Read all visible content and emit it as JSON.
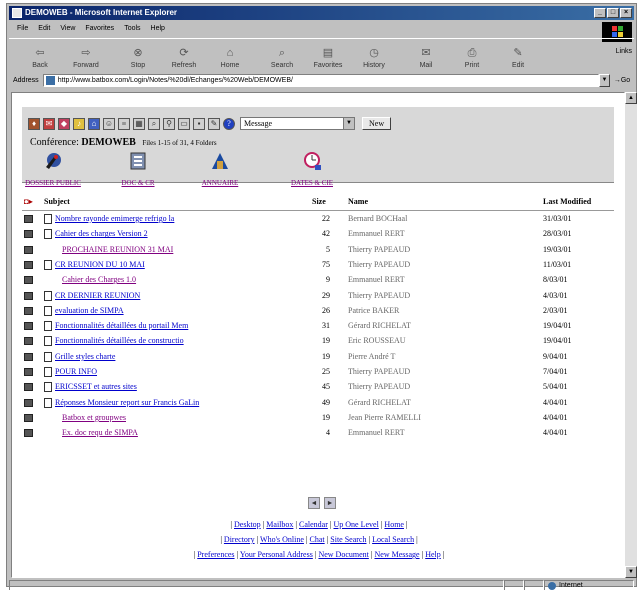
{
  "window": {
    "title": "DEMOWEB - Microsoft Internet Explorer",
    "controls": [
      "_",
      "□",
      "×"
    ]
  },
  "menu": [
    "File",
    "Edit",
    "View",
    "Favorites",
    "Tools",
    "Help"
  ],
  "toolbar": [
    {
      "label": "Back",
      "icon": "back-arrow-icon",
      "glyph": "⇦"
    },
    {
      "label": "Forward",
      "icon": "forward-arrow-icon",
      "glyph": "⇨"
    },
    {
      "label": "Stop",
      "icon": "stop-icon",
      "glyph": "⊗"
    },
    {
      "label": "Refresh",
      "icon": "refresh-icon",
      "glyph": "⟳"
    },
    {
      "label": "Home",
      "icon": "home-icon",
      "glyph": "⌂"
    },
    {
      "label": "Search",
      "icon": "search-icon",
      "glyph": "⌕"
    },
    {
      "label": "Favorites",
      "icon": "favorites-icon",
      "glyph": "▤"
    },
    {
      "label": "History",
      "icon": "history-icon",
      "glyph": "◷"
    },
    {
      "label": "Mail",
      "icon": "mail-icon",
      "glyph": "✉"
    },
    {
      "label": "Print",
      "icon": "print-icon",
      "glyph": "⎙"
    },
    {
      "label": "Edit",
      "icon": "edit-icon",
      "glyph": "✎"
    }
  ],
  "links_label": "Links",
  "address": {
    "label": "Address",
    "url": "http://www.batbox.com/Login/Notes/%20dl/Echanges/%20Web/DEMOWEB/",
    "go_label": "Go"
  },
  "page": {
    "message_select": "Message",
    "new_button": "New",
    "conference_label": "Conférence:",
    "conference_name": "DEMOWEB",
    "conference_info": "Files 1-15 of 31, 4 Folders",
    "folders": [
      {
        "label": "DOSSIER PUBLIC",
        "icon": "public-folder-icon"
      },
      {
        "label": "DOC & CR",
        "icon": "documents-folder-icon"
      },
      {
        "label": "ANNUAIRE",
        "icon": "directory-folder-icon"
      },
      {
        "label": "DATES & CIE",
        "icon": "calendar-folder-icon"
      }
    ],
    "columns": {
      "subject": "Subject",
      "size": "Size",
      "name": "Name",
      "modified": "Last Modified"
    },
    "rows": [
      {
        "subject": "Nombre rayonde emimerge refrigo la",
        "indent": false,
        "size": "22",
        "name": "Bernard BOCHaal",
        "date": "31/03/01"
      },
      {
        "subject": "Cahier des charges Version 2",
        "indent": false,
        "size": "42",
        "name": "Emmanuel RERT",
        "date": "28/03/01"
      },
      {
        "subject": "PROCHAINE REUNION 31 MAI",
        "indent": true,
        "size": "5",
        "name": "Thierry PAPEAUD",
        "date": "19/03/01"
      },
      {
        "subject": "CR REUNION DU 10 MAI",
        "indent": false,
        "size": "75",
        "name": "Thierry PAPEAUD",
        "date": "11/03/01"
      },
      {
        "subject": "Cahier des Charges 1.0",
        "indent": true,
        "size": "9",
        "name": "Emmanuel RERT",
        "date": "8/03/01"
      },
      {
        "subject": "CR DERNIER REUNION",
        "indent": false,
        "size": "29",
        "name": "Thierry PAPEAUD",
        "date": "4/03/01"
      },
      {
        "subject": "evaluation de SIMPA",
        "indent": false,
        "size": "26",
        "name": "Patrice BAKER",
        "date": "2/03/01"
      },
      {
        "subject": "Fonctionnalités détaillées du portail Mem",
        "indent": false,
        "size": "31",
        "name": "Gérard RICHELAT",
        "date": "19/04/01"
      },
      {
        "subject": "Fonctionnalités détaillées de constructio",
        "indent": false,
        "size": "19",
        "name": "Eric ROUSSEAU",
        "date": "19/04/01"
      },
      {
        "subject": "Grille styles charte",
        "indent": false,
        "size": "19",
        "name": "Pierre André T",
        "date": "9/04/01"
      },
      {
        "subject": "POUR INFO",
        "indent": false,
        "size": "25",
        "name": "Thierry PAPEAUD",
        "date": "7/04/01"
      },
      {
        "subject": "ERICSSET et autres sites",
        "indent": false,
        "size": "45",
        "name": "Thierry PAPEAUD",
        "date": "5/04/01"
      },
      {
        "subject": "Réponses Monsieur report sur Francis GaLin",
        "indent": false,
        "size": "49",
        "name": "Gérard RICHELAT",
        "date": "4/04/01"
      },
      {
        "subject": "Batbox et groupwes",
        "indent": true,
        "size": "19",
        "name": "Jean Pierre RAMELLI",
        "date": "4/04/01"
      },
      {
        "subject": "Ex. doc requ de SIMPA",
        "indent": true,
        "size": "4",
        "name": "Emmanuel RERT",
        "date": "4/04/01"
      }
    ],
    "pager": [
      "◄",
      "►"
    ],
    "footer_lines": [
      [
        "Desktop",
        "Mailbox",
        "Calendar",
        "Up One Level",
        "Home"
      ],
      [
        "Directory",
        "Who's Online",
        "Chat",
        "Site Search",
        "Local Search"
      ],
      [
        "Preferences",
        "Your Personal Address",
        "New Document",
        "New Message",
        "Help"
      ]
    ]
  },
  "status": {
    "zone": "Internet"
  }
}
